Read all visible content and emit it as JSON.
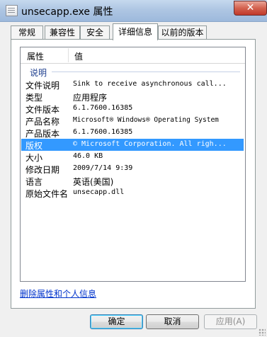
{
  "window": {
    "title": "unsecapp.exe 属性",
    "close_glyph": "✕"
  },
  "tabs": [
    {
      "label": "常规"
    },
    {
      "label": "兼容性"
    },
    {
      "label": "安全"
    },
    {
      "label": "详细信息",
      "active": true
    },
    {
      "label": "以前的版本"
    }
  ],
  "details": {
    "columns": {
      "property": "属性",
      "value": "值"
    },
    "group": "说明",
    "rows": [
      {
        "key": "文件说明",
        "value": "Sink to receive asynchronous call..."
      },
      {
        "key": "类型",
        "value": "应用程序"
      },
      {
        "key": "文件版本",
        "value": "6.1.7600.16385"
      },
      {
        "key": "产品名称",
        "value": "Microsoft® Windows® Operating System"
      },
      {
        "key": "产品版本",
        "value": "6.1.7600.16385"
      },
      {
        "key": "版权",
        "value": "© Microsoft Corporation. All righ...",
        "selected": true
      },
      {
        "key": "大小",
        "value": "46.0 KB"
      },
      {
        "key": "修改日期",
        "value": "2009/7/14 9:39"
      },
      {
        "key": "语言",
        "value": "英语(美国)"
      },
      {
        "key": "原始文件名",
        "value": "unsecapp.dll"
      }
    ]
  },
  "link": {
    "remove_props": "删除属性和个人信息"
  },
  "buttons": {
    "ok": "确定",
    "cancel": "取消",
    "apply": "应用(A)"
  },
  "colors": {
    "selection": "#3399ff",
    "link": "#0033cc",
    "group_header": "#1e3f8f"
  }
}
